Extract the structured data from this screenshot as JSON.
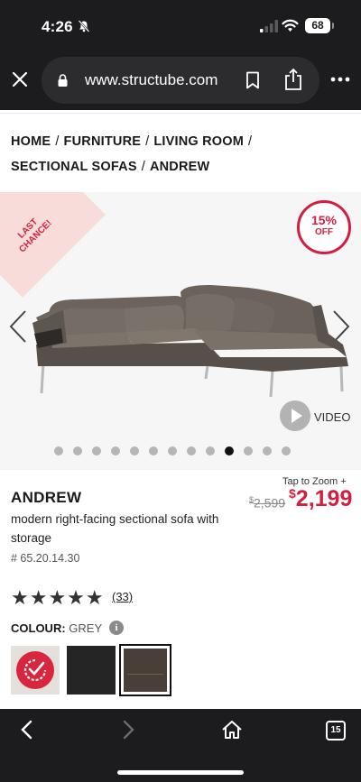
{
  "status_bar": {
    "time": "4:26",
    "battery": "68",
    "icons": [
      "bell-slash-icon",
      "signal-icon",
      "wifi-icon",
      "battery-icon"
    ]
  },
  "browser": {
    "url": "www.structube.com",
    "icons": [
      "close-icon",
      "lock-icon",
      "bookmark-icon",
      "share-icon",
      "more-icon"
    ]
  },
  "breadcrumb": {
    "items": [
      "HOME",
      "FURNITURE",
      "LIVING ROOM",
      "SECTIONAL SOFAS",
      "ANDREW"
    ],
    "separator": "/"
  },
  "gallery": {
    "ribbon": "LAST CHANCE!",
    "badge_pct": "15%",
    "badge_off": "OFF",
    "video_label": "VIDEO",
    "dot_count": 13,
    "active_dot": 9
  },
  "product": {
    "tap_to_zoom": "Tap to Zoom +",
    "name": "ANDREW",
    "old_price_currency": "$",
    "old_price": "2,599",
    "new_price_currency": "$",
    "new_price": "2,199",
    "description": "modern right-facing sectional sofa with storage",
    "sku": "# 65.20.14.30",
    "rating_stars": "★★★★★",
    "rating": 5,
    "review_count": "(33)",
    "colour_label": "COLOUR:",
    "colour_value": "GREY",
    "info_glyph": "i"
  },
  "bottom_bar": {
    "tab_count": "15"
  },
  "colors": {
    "accent": "#d31f3f",
    "chrome": "#1c1c1e"
  }
}
